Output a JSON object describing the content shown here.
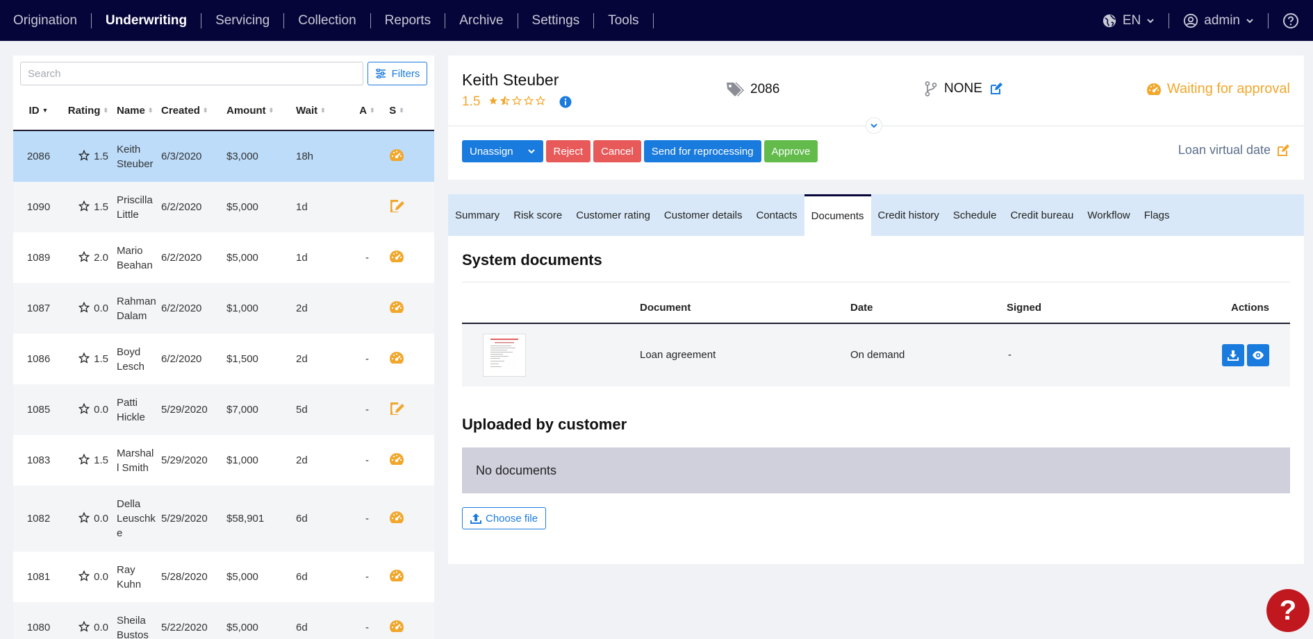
{
  "nav": {
    "items": [
      {
        "label": "Origination",
        "active": false
      },
      {
        "label": "Underwriting",
        "active": true
      },
      {
        "label": "Servicing",
        "active": false
      },
      {
        "label": "Collection",
        "active": false
      },
      {
        "label": "Reports",
        "active": false
      },
      {
        "label": "Archive",
        "active": false
      },
      {
        "label": "Settings",
        "active": false
      },
      {
        "label": "Tools",
        "active": false
      }
    ],
    "language": "EN",
    "user": "admin",
    "icons": [
      "globe-icon",
      "user-circle-icon",
      "help-circle-icon"
    ]
  },
  "list": {
    "search_placeholder": "Search",
    "filters_label": "Filters",
    "columns": {
      "id": "ID",
      "rating": "Rating",
      "name": "Name",
      "created": "Created",
      "amount": "Amount",
      "wait": "Wait",
      "a": "A",
      "s": "S"
    },
    "rows": [
      {
        "id": "2086",
        "rating": "1.5",
        "name": [
          "Keith",
          "Steuber"
        ],
        "created": "6/3/2020",
        "amount": "$3,000",
        "wait": "18h",
        "a": "",
        "status_icon": "gauge-icon",
        "selected": true
      },
      {
        "id": "1090",
        "rating": "1.5",
        "name": [
          "Priscilla",
          "Little"
        ],
        "created": "6/2/2020",
        "amount": "$5,000",
        "wait": "1d",
        "a": "",
        "status_icon": "edit-document-icon"
      },
      {
        "id": "1089",
        "rating": "2.0",
        "name": [
          "Mario",
          "Beahan"
        ],
        "created": "6/2/2020",
        "amount": "$5,000",
        "wait": "1d",
        "a": "-",
        "status_icon": "gauge-icon"
      },
      {
        "id": "1087",
        "rating": "0.0",
        "name": [
          "Rahman",
          "Dalam"
        ],
        "created": "6/2/2020",
        "amount": "$1,000",
        "wait": "2d",
        "a": "",
        "status_icon": "gauge-icon"
      },
      {
        "id": "1086",
        "rating": "1.5",
        "name": [
          "Boyd",
          "Lesch"
        ],
        "created": "6/2/2020",
        "amount": "$1,500",
        "wait": "2d",
        "a": "-",
        "status_icon": "gauge-icon"
      },
      {
        "id": "1085",
        "rating": "0.0",
        "name": [
          "Patti",
          "Hickle"
        ],
        "created": "5/29/2020",
        "amount": "$7,000",
        "wait": "5d",
        "a": "-",
        "status_icon": "edit-document-icon"
      },
      {
        "id": "1083",
        "rating": "1.5",
        "name": [
          "Marshal",
          "l Smith"
        ],
        "created": "5/29/2020",
        "amount": "$1,000",
        "wait": "2d",
        "a": "-",
        "status_icon": "gauge-icon"
      },
      {
        "id": "1082",
        "rating": "0.0",
        "name": [
          "Della",
          "Leuschk",
          "e"
        ],
        "created": "5/29/2020",
        "amount": "$58,901",
        "wait": "6d",
        "a": "-",
        "status_icon": "gauge-icon"
      },
      {
        "id": "1081",
        "rating": "0.0",
        "name": [
          "Ray",
          "Kuhn"
        ],
        "created": "5/28/2020",
        "amount": "$5,000",
        "wait": "6d",
        "a": "-",
        "status_icon": "gauge-icon"
      },
      {
        "id": "1080",
        "rating": "0.0",
        "name": [
          "Sheila",
          "Bustos"
        ],
        "created": "5/22/2020",
        "amount": "$5,000",
        "wait": "6d",
        "a": "-",
        "status_icon": "gauge-icon"
      }
    ]
  },
  "header": {
    "customer_name": "Keith Steuber",
    "rating": "1.5",
    "stars_filled": 1.5,
    "stars_total": 5,
    "loan_id": "2086",
    "branch": "NONE",
    "status": "Waiting for approval",
    "loan_virtual_date_label": "Loan virtual date",
    "actions": {
      "unassign": "Unassign",
      "reject": "Reject",
      "cancel": "Cancel",
      "reprocess": "Send for reprocessing",
      "approve": "Approve"
    }
  },
  "tabs": [
    {
      "label": "Summary"
    },
    {
      "label": "Risk score"
    },
    {
      "label": "Customer rating"
    },
    {
      "label": "Customer details"
    },
    {
      "label": "Contacts"
    },
    {
      "label": "Documents",
      "active": true
    },
    {
      "label": "Credit history"
    },
    {
      "label": "Schedule"
    },
    {
      "label": "Credit bureau"
    },
    {
      "label": "Workflow"
    },
    {
      "label": "Flags"
    }
  ],
  "documents": {
    "system_title": "System documents",
    "columns": {
      "document": "Document",
      "date": "Date",
      "signed": "Signed",
      "actions": "Actions"
    },
    "rows": [
      {
        "document": "Loan agreement",
        "date": "On demand",
        "signed": "-"
      }
    ],
    "uploaded_title": "Uploaded by customer",
    "no_documents": "No documents",
    "choose_file": "Choose file"
  },
  "help_label": "?",
  "colors": {
    "nav_bg": "#06053a",
    "primary": "#1a7bde",
    "danger": "#e85a5a",
    "success": "#62bb4b",
    "warning": "#f1a72c",
    "selected_row": "#bcdcfa",
    "tab_bar": "#d8e8f8",
    "help_fab": "#c0181e"
  }
}
